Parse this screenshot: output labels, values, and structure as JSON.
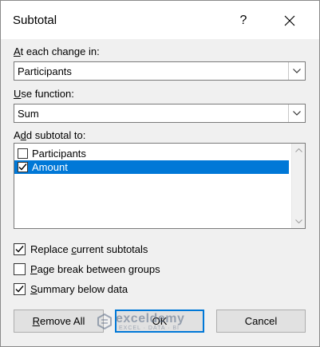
{
  "dialog": {
    "title": "Subtotal",
    "help_glyph": "?"
  },
  "at_each_change": {
    "label_access": "A",
    "label_rest": "t each change in:",
    "value": "Participants"
  },
  "use_function": {
    "label_access": "U",
    "label_rest": "se function:",
    "value": "Sum"
  },
  "add_subtotal": {
    "label_pre": "A",
    "label_access": "d",
    "label_rest": "d subtotal to:",
    "items": [
      {
        "label": "Participants",
        "checked": false,
        "selected": false
      },
      {
        "label": "Amount",
        "checked": true,
        "selected": true
      }
    ]
  },
  "options": {
    "replace": {
      "pre": "Replace ",
      "access": "c",
      "rest": "urrent subtotals",
      "checked": true
    },
    "page_break": {
      "pre": "",
      "access": "P",
      "rest": "age break between groups",
      "checked": false
    },
    "summary": {
      "pre": "",
      "access": "S",
      "rest": "ummary below data",
      "checked": true
    }
  },
  "buttons": {
    "remove_all": {
      "access": "R",
      "rest": "emove All"
    },
    "ok": "OK",
    "cancel": "Cancel"
  },
  "watermark": {
    "name": "exceldemy",
    "tagline": "EXCEL · DATA · BI"
  },
  "colors": {
    "selection": "#0078d7",
    "dialog_bg": "#f0f0f0"
  }
}
